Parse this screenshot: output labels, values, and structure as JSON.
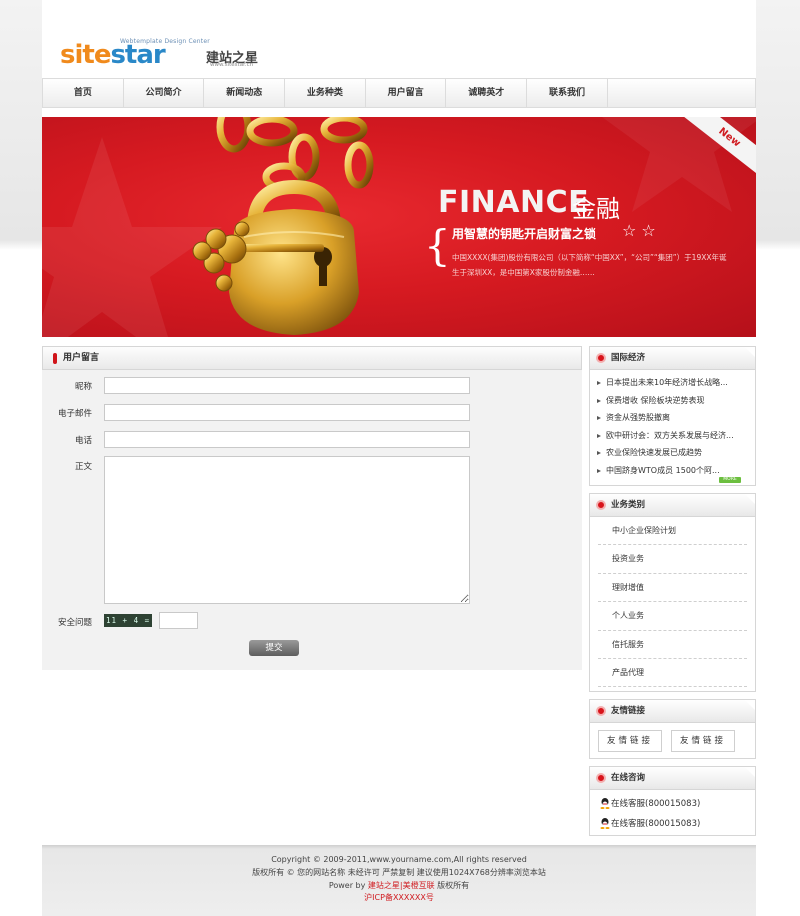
{
  "logo": {
    "tagline": "Webtemplate Design Center",
    "word_orange": "site",
    "word_blue": "star",
    "cn_name": "建站之星",
    "url": "www.sitestar.cn"
  },
  "nav": [
    "首页",
    "公司简介",
    "新闻动态",
    "业务种类",
    "用户留言",
    "诚聘英才",
    "联系我们"
  ],
  "banner": {
    "ribbon": "New",
    "title_en": "FINANCE",
    "title_cn": "金融",
    "slogan": "用智慧的钥匙开启财富之锁",
    "description": "中国XXXX(集团)股份有限公司（以下简称“中国XX”，“公司”“集团”）于19XX年诞生于深圳XX，是中国第X家股份制金融……"
  },
  "form": {
    "title": "用户留言",
    "label_nickname": "昵称",
    "label_email": "电子邮件",
    "label_phone": "电话",
    "label_content": "正文",
    "label_security": "安全问题",
    "captcha": "11 + 4 =",
    "submit": "提交"
  },
  "sidebar": {
    "news": {
      "title": "国际经济",
      "items": [
        "日本提出未来10年经济增长战略...",
        "保费增收 保险板块逆势表现",
        "资金从强势股撤离",
        "欧中研讨会：双方关系发展与经济...",
        "农业保险快速发展已成趋势",
        "中国跻身WTO成员 1500个阿..."
      ],
      "more": "MORE"
    },
    "categories": {
      "title": "业务类别",
      "items": [
        "中小企业保险计划",
        "投资业务",
        "理财增值",
        "个人业务",
        "信托服务",
        "产品代理"
      ]
    },
    "links": {
      "title": "友情链接",
      "items": [
        "友情链接",
        "友情链接"
      ]
    },
    "contact": {
      "title": "在线咨询",
      "items": [
        "在线客服(800015083)",
        "在线客服(800015083)"
      ]
    }
  },
  "footer": {
    "line1": "Copyright © 2009-2011,www.yourname.com,All rights reserved",
    "line2": "版权所有 © 您的网站名称  未经许可  严禁复制  建议使用1024X768分辨率浏览本站",
    "line3_prefix": "Power by",
    "line3_link": "建站之星|美橙互联",
    "line3_suffix": "版权所有",
    "icp": "沪ICP备XXXXXX号"
  },
  "colors": {
    "brand_red": "#d01b20",
    "logo_orange": "#f08a1c",
    "logo_blue": "#2a88c8",
    "more_green": "#6cbf3f"
  }
}
